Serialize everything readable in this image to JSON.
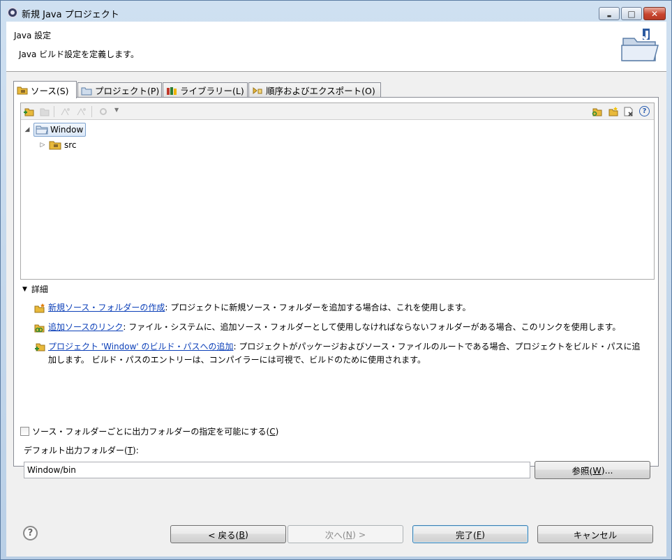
{
  "window": {
    "title": "新規 Java プロジェクト",
    "minimize_glyph": "▬",
    "maximize_glyph": "□",
    "close_glyph": "✕"
  },
  "header": {
    "title": "Java 設定",
    "description": "Java ビルド設定を定義します。"
  },
  "tabs": [
    {
      "label": "ソース(S)",
      "icon": "source-folder-icon",
      "active": true
    },
    {
      "label": "プロジェクト(P)",
      "icon": "project-folder-icon",
      "active": false
    },
    {
      "label": "ライブラリー(L)",
      "icon": "library-icon",
      "active": false
    },
    {
      "label": "順序およびエクスポート(O)",
      "icon": "order-export-icon",
      "active": false
    }
  ],
  "tree": {
    "project": "Window",
    "children": [
      {
        "label": "src"
      }
    ]
  },
  "details": {
    "heading": "詳細",
    "items": [
      {
        "link": "新規ソース・フォルダーの作成",
        "text": ": プロジェクトに新規ソース・フォルダーを追加する場合は、これを使用します。",
        "icon": "new-source-folder-icon"
      },
      {
        "link": "追加ソースのリンク",
        "text": ": ファイル・システムに、追加ソース・フォルダーとして使用しなければならないフォルダーがある場合、このリンクを使用します。",
        "icon": "link-source-icon"
      },
      {
        "link": "プロジェクト 'Window' のビルド・パスへの追加",
        "text": ": プロジェクトがパッケージおよびソース・ファイルのルートである場合、プロジェクトをビルド・パスに追加します。 ビルド・パスのエントリーは、コンパイラーには可視で、ビルドのために使用されます。",
        "icon": "add-to-build-path-icon"
      }
    ]
  },
  "output_folder_checkbox": {
    "label_before": "ソース・フォルダーごとに出力フォルダーの指定を可能にする(",
    "mnemonic": "C",
    "label_after": ")",
    "checked": false
  },
  "default_output": {
    "label_before": "デフォルト出力フォルダー(",
    "mnemonic": "T",
    "label_after": "):",
    "value": "Window/bin"
  },
  "browse_button": {
    "before": "参照(",
    "mnemonic": "W",
    "after": ")..."
  },
  "footer": {
    "help_glyph": "?",
    "back": {
      "before": "< 戻る(",
      "mnemonic": "B",
      "after": ")"
    },
    "next": {
      "before": "次へ(",
      "mnemonic": "N",
      "after": ") >"
    },
    "finish": {
      "before": "完了(",
      "mnemonic": "F",
      "after": ")"
    },
    "cancel": "キャンセル"
  },
  "colors": {
    "link": "#0b3fb8",
    "folder_yellow": "#e8b93b",
    "selection": "#dbe8f8"
  }
}
